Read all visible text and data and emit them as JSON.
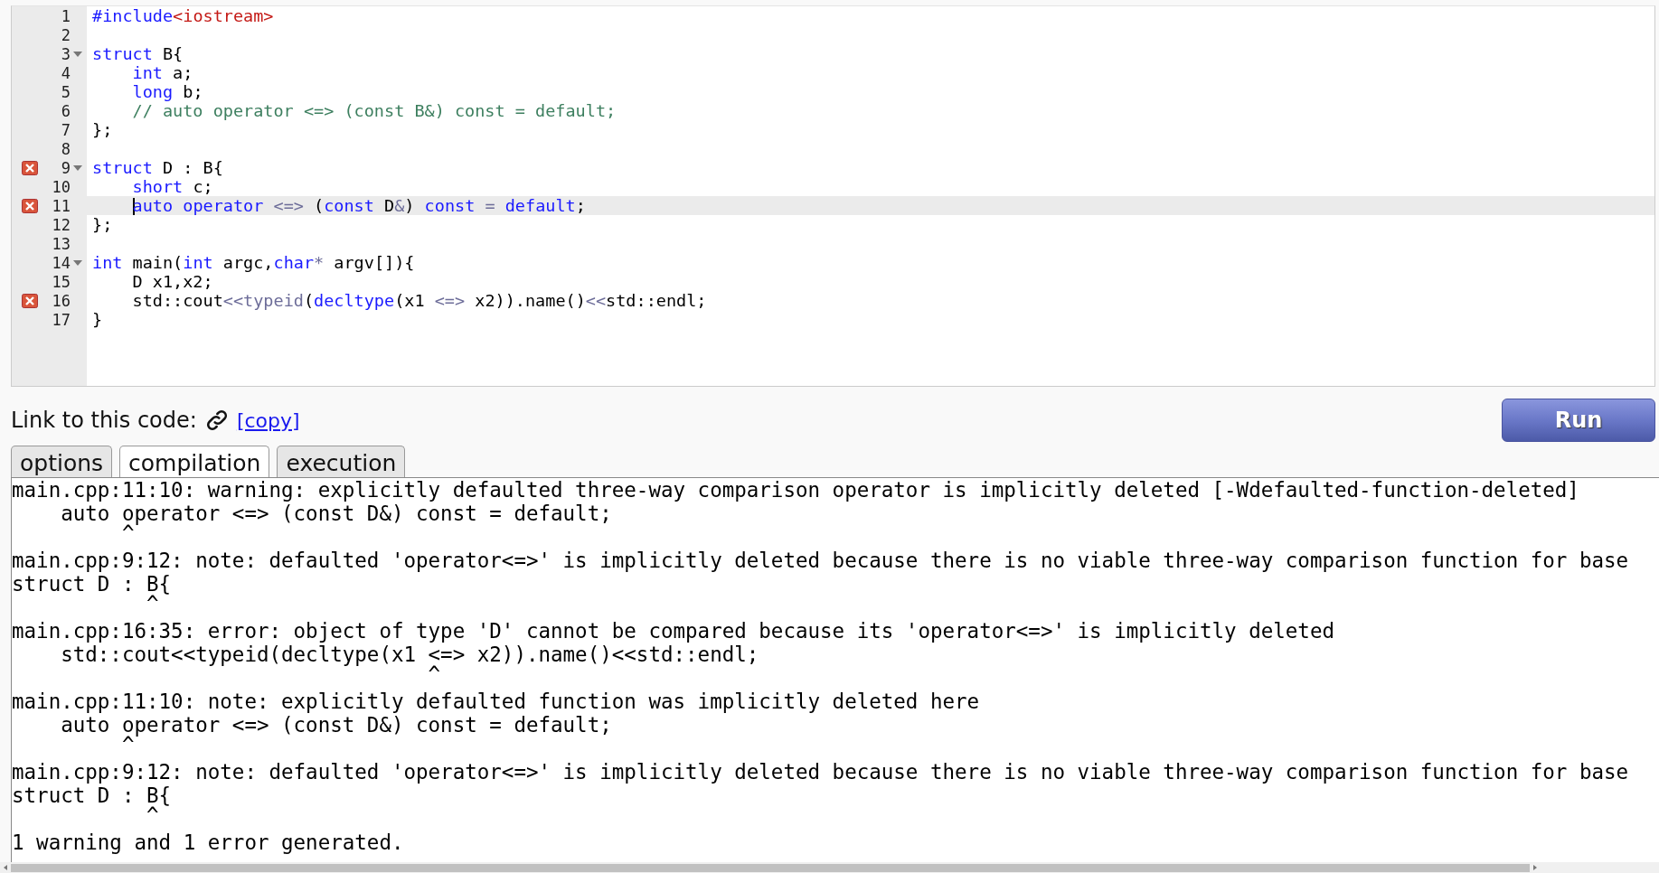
{
  "editor": {
    "lines": [
      {
        "number": "1",
        "error": false,
        "fold": false,
        "active": false,
        "indent": false,
        "tokens": [
          {
            "text": "#include",
            "kind": "kw"
          },
          {
            "text": "<iostream>",
            "kind": "str"
          }
        ]
      },
      {
        "number": "2",
        "error": false,
        "fold": false,
        "active": false,
        "indent": false
      },
      {
        "number": "3",
        "error": false,
        "fold": true,
        "active": false,
        "indent": false,
        "tokens": [
          {
            "text": "struct",
            "kind": "kw"
          },
          {
            "text": " B{",
            "kind": "plain"
          }
        ]
      },
      {
        "number": "4",
        "error": false,
        "fold": false,
        "active": false,
        "indent": true,
        "tokens": [
          {
            "text": "int",
            "kind": "kw"
          },
          {
            "text": " a;",
            "kind": "plain"
          }
        ]
      },
      {
        "number": "5",
        "error": false,
        "fold": false,
        "active": false,
        "indent": true,
        "tokens": [
          {
            "text": "long",
            "kind": "kw"
          },
          {
            "text": " b;",
            "kind": "plain"
          }
        ]
      },
      {
        "number": "6",
        "error": false,
        "fold": false,
        "active": false,
        "indent": true,
        "tokens": [
          {
            "text": "// auto operator <=> (const B&) const = default;",
            "kind": "comment"
          }
        ]
      },
      {
        "number": "7",
        "error": false,
        "fold": false,
        "active": false,
        "indent": false,
        "tokens": [
          {
            "text": "};",
            "kind": "plain"
          }
        ]
      },
      {
        "number": "8",
        "error": false,
        "fold": false,
        "active": false,
        "indent": false
      },
      {
        "number": "9",
        "error": true,
        "fold": true,
        "active": false,
        "indent": false,
        "tokens": [
          {
            "text": "struct",
            "kind": "kw"
          },
          {
            "text": " D : B{",
            "kind": "plain"
          }
        ]
      },
      {
        "number": "10",
        "error": false,
        "fold": false,
        "active": false,
        "indent": true,
        "tokens": [
          {
            "text": "short",
            "kind": "kw"
          },
          {
            "text": " c;",
            "kind": "plain"
          }
        ]
      },
      {
        "number": "11",
        "error": true,
        "fold": false,
        "active": true,
        "indent": true,
        "tokens": [
          {
            "text": "auto",
            "kind": "kw",
            "cursor": true
          },
          {
            "text": " operator",
            "kind": "kw"
          },
          {
            "text": " <=>",
            "kind": "op"
          },
          {
            "text": " (",
            "kind": "plain"
          },
          {
            "text": "const",
            "kind": "kw"
          },
          {
            "text": " D",
            "kind": "plain"
          },
          {
            "text": "&",
            "kind": "op"
          },
          {
            "text": ")",
            "kind": "plain"
          },
          {
            "text": " const",
            "kind": "kw"
          },
          {
            "text": " =",
            "kind": "op"
          },
          {
            "text": " default",
            "kind": "kw"
          },
          {
            "text": ";",
            "kind": "plain"
          }
        ]
      },
      {
        "number": "12",
        "error": false,
        "fold": false,
        "active": false,
        "indent": false,
        "tokens": [
          {
            "text": "};",
            "kind": "plain"
          }
        ]
      },
      {
        "number": "13",
        "error": false,
        "fold": false,
        "active": false,
        "indent": false
      },
      {
        "number": "14",
        "error": false,
        "fold": true,
        "active": false,
        "indent": false,
        "tokens": [
          {
            "text": "int",
            "kind": "kw"
          },
          {
            "text": " main(",
            "kind": "plain"
          },
          {
            "text": "int",
            "kind": "kw"
          },
          {
            "text": " argc,",
            "kind": "plain"
          },
          {
            "text": "char",
            "kind": "kw"
          },
          {
            "text": "*",
            "kind": "op"
          },
          {
            "text": " argv[]){",
            "kind": "plain"
          }
        ]
      },
      {
        "number": "15",
        "error": false,
        "fold": false,
        "active": false,
        "indent": true,
        "tokens": [
          {
            "text": "D x1,x2;",
            "kind": "plain"
          }
        ]
      },
      {
        "number": "16",
        "error": true,
        "fold": false,
        "active": false,
        "indent": true,
        "tokens": [
          {
            "text": "std::cout",
            "kind": "plain"
          },
          {
            "text": "<<",
            "kind": "op"
          },
          {
            "text": "typeid",
            "kind": "op"
          },
          {
            "text": "(",
            "kind": "plain"
          },
          {
            "text": "decltype",
            "kind": "kw"
          },
          {
            "text": "(x1 ",
            "kind": "plain"
          },
          {
            "text": "<=>",
            "kind": "op"
          },
          {
            "text": " x2)).name()",
            "kind": "plain"
          },
          {
            "text": "<<",
            "kind": "op"
          },
          {
            "text": "std::endl;",
            "kind": "plain"
          }
        ]
      },
      {
        "number": "17",
        "error": false,
        "fold": false,
        "active": false,
        "indent": false,
        "tokens": [
          {
            "text": "}",
            "kind": "plain"
          }
        ]
      }
    ]
  },
  "link": {
    "label": "Link to this code:",
    "copy": "[copy]"
  },
  "run_button": "Run",
  "tabs": [
    {
      "label": "options",
      "selected": false
    },
    {
      "label": "compilation",
      "selected": true
    },
    {
      "label": "execution",
      "selected": false
    }
  ],
  "output": [
    [
      "main.cpp:11:10: warning: explicitly defaulted three-way comparison operator is implicitly deleted [-Wdefaulted-function-deleted]",
      "    auto operator <=> (const D&) const = default;",
      "         ^"
    ],
    [
      "main.cpp:9:12: note: defaulted 'operator<=>' is implicitly deleted because there is no viable three-way comparison function for base",
      "struct D : B{",
      "           ^"
    ],
    [
      "main.cpp:16:35: error: object of type 'D' cannot be compared because its 'operator<=>' is implicitly deleted",
      "    std::cout<<typeid(decltype(x1 <=> x2)).name()<<std::endl;",
      "                                  ^"
    ],
    [
      "main.cpp:11:10: note: explicitly defaulted function was implicitly deleted here",
      "    auto operator <=> (const D&) const = default;",
      "         ^"
    ],
    [
      "main.cpp:9:12: note: defaulted 'operator<=>' is implicitly deleted because there is no viable three-way comparison function for base",
      "struct D : B{",
      "           ^"
    ],
    [
      "1 warning and 1 error generated."
    ]
  ]
}
